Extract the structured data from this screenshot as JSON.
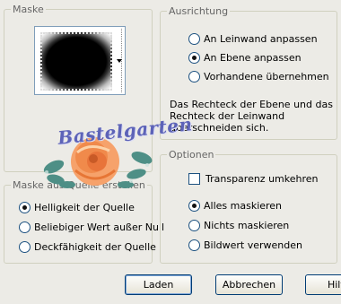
{
  "mask_group": {
    "legend": "Maske",
    "dropdown_arrow_icon": "chevron-down-icon"
  },
  "mask_source_group": {
    "legend": "Maske aus Quelle erstellen",
    "options": [
      {
        "label": "Helligkeit der Quelle",
        "checked": true
      },
      {
        "label": "Beliebiger Wert außer Null",
        "checked": false
      },
      {
        "label": "Deckfähigkeit der Quelle",
        "checked": false
      }
    ]
  },
  "alignment_group": {
    "legend": "Ausrichtung",
    "options": [
      {
        "label": "An Leinwand anpassen",
        "checked": false
      },
      {
        "label": "An Ebene anpassen",
        "checked": true
      },
      {
        "label": "Vorhandene übernehmen",
        "checked": false
      }
    ],
    "description": "Das Rechteck der Ebene und das Rechteck der Leinwand überschneiden sich."
  },
  "options_group": {
    "legend": "Optionen",
    "invert_label": "Transparenz umkehren",
    "invert_checked": false,
    "options": [
      {
        "label": "Alles maskieren",
        "checked": true
      },
      {
        "label": "Nichts maskieren",
        "checked": false
      },
      {
        "label": "Bildwert verwenden",
        "checked": false
      }
    ]
  },
  "buttons": {
    "load": "Laden",
    "cancel": "Abbrechen",
    "help": "Hilfe"
  },
  "watermark": {
    "text": "Bastelgarten",
    "colors": {
      "text": "#5d63b8",
      "rose": "#f08a4b"
    }
  }
}
